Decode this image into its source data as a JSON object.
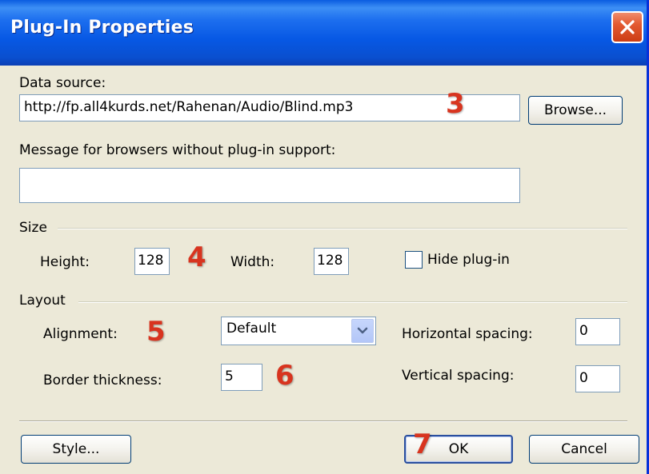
{
  "window": {
    "title": "Plug-In Properties"
  },
  "data_source": {
    "label": "Data source:",
    "value": "http://fp.all4kurds.net/Rahenan/Audio/Blind.mp3",
    "browse_label": "Browse..."
  },
  "message": {
    "label": "Message for browsers without plug-in support:",
    "value": ""
  },
  "size": {
    "group_label": "Size",
    "height_label": "Height:",
    "height_value": "128",
    "width_label": "Width:",
    "width_value": "128",
    "hide_label": "Hide plug-in",
    "hide_checked": false
  },
  "layout": {
    "group_label": "Layout",
    "alignment_label": "Alignment:",
    "alignment_value": "Default",
    "border_label": "Border thickness:",
    "border_value": "5",
    "hspace_label": "Horizontal spacing:",
    "hspace_value": "0",
    "vspace_label": "Vertical spacing:",
    "vspace_value": "0"
  },
  "buttons": {
    "style_label": "Style...",
    "ok_label": "OK",
    "cancel_label": "Cancel"
  },
  "annotations": {
    "a3": "3",
    "a4": "4",
    "a5": "5",
    "a6": "6",
    "a7": "7"
  },
  "colors": {
    "titlebar": "#0758e4",
    "dialog_bg": "#ece9d8",
    "annotation": "#d8341f"
  }
}
